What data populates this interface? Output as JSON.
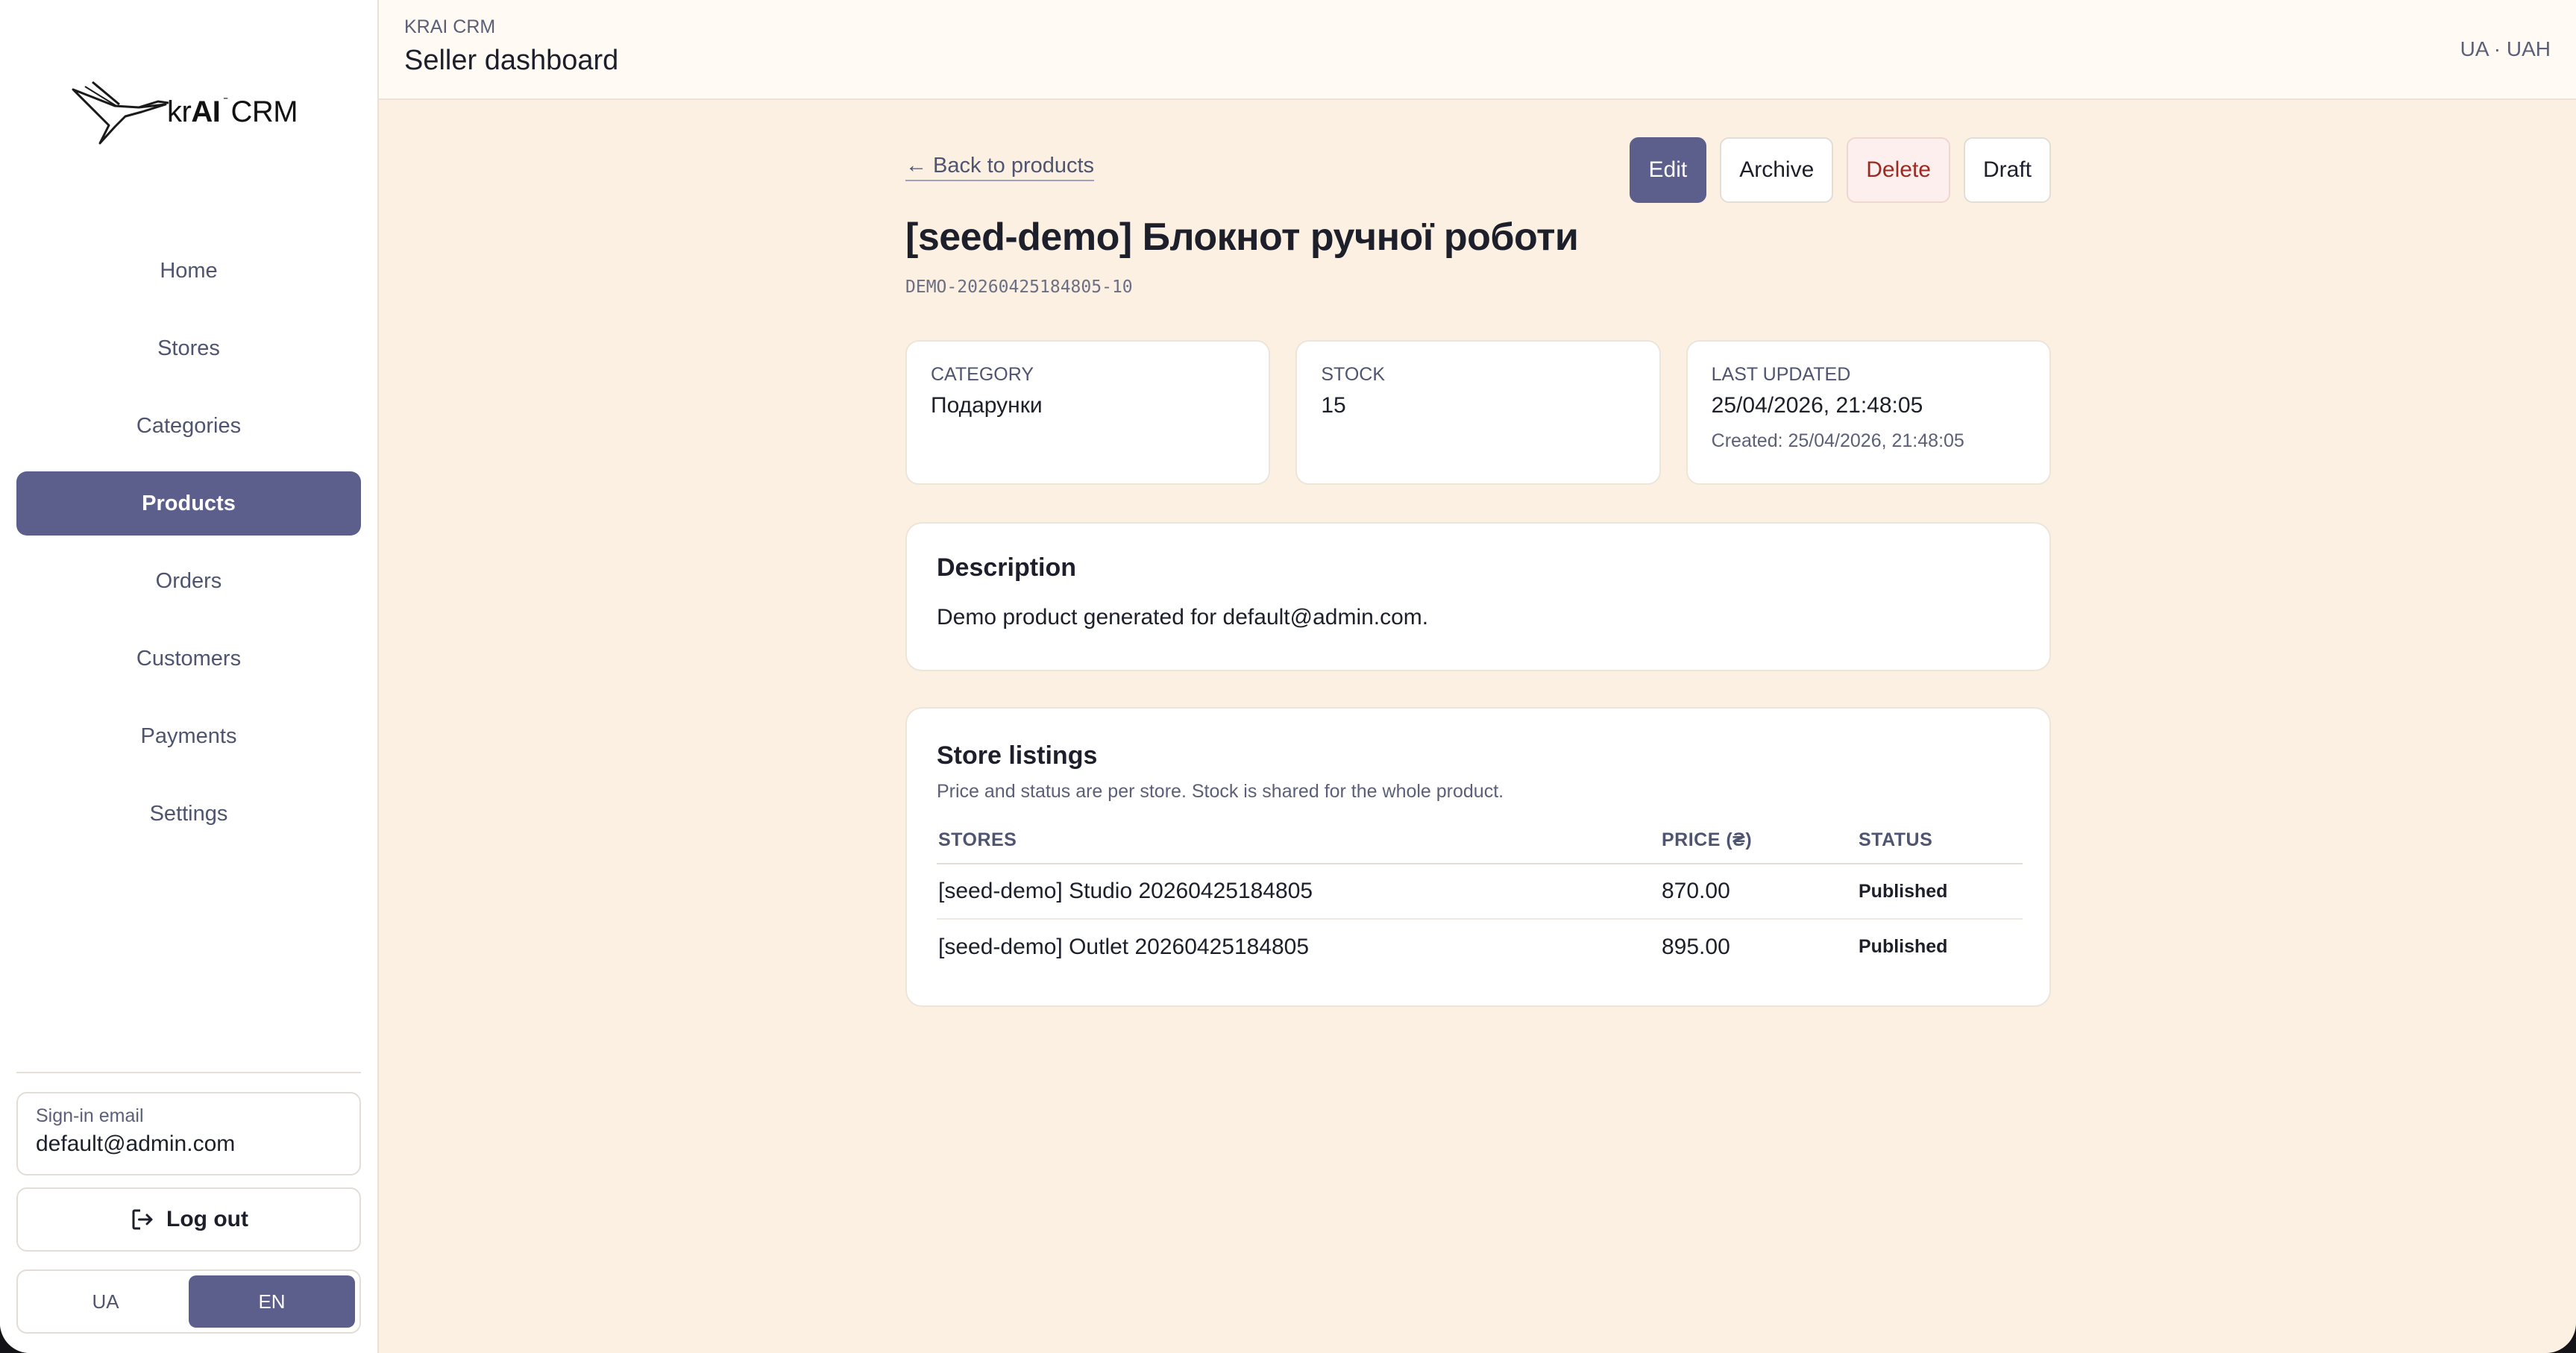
{
  "sidebar": {
    "logo": {
      "prefix": "kr",
      "ai": "AI",
      "sup": "ˉ",
      "suffix": "CRM"
    },
    "nav": [
      {
        "label": "Home"
      },
      {
        "label": "Stores"
      },
      {
        "label": "Categories"
      },
      {
        "label": "Products",
        "active": true
      },
      {
        "label": "Orders"
      },
      {
        "label": "Customers"
      },
      {
        "label": "Payments"
      },
      {
        "label": "Settings"
      }
    ],
    "signin_label": "Sign-in email",
    "signin_email": "default@admin.com",
    "logout_label": "Log out",
    "languages": [
      {
        "label": "UA",
        "active": false
      },
      {
        "label": "EN",
        "active": true
      }
    ]
  },
  "header": {
    "app_name": "KRAI CRM",
    "title": "Seller dashboard",
    "locale": "UA · UAH"
  },
  "product": {
    "back_link": "← Back to products",
    "actions": {
      "edit": "Edit",
      "archive": "Archive",
      "delete": "Delete",
      "draft": "Draft"
    },
    "title": "[seed-demo] Блокнот ручної роботи",
    "sku": "DEMO-20260425184805-10",
    "category_label": "CATEGORY",
    "category_value": "Подарунки",
    "stock_label": "STOCK",
    "stock_value": "15",
    "updated_label": "LAST UPDATED",
    "updated_value": "25/04/2026, 21:48:05",
    "created_text": "Created: 25/04/2026, 21:48:05"
  },
  "description": {
    "title": "Description",
    "text": "Demo product generated for default@admin.com."
  },
  "listings": {
    "title": "Store listings",
    "subtitle": "Price and status are per store. Stock is shared for the whole product.",
    "columns": [
      "STORES",
      "PRICE (₴)",
      "STATUS"
    ],
    "rows": [
      {
        "store": "[seed-demo] Studio 20260425184805",
        "price": "870.00",
        "status": "Published"
      },
      {
        "store": "[seed-demo] Outlet 20260425184805",
        "price": "895.00",
        "status": "Published"
      }
    ]
  },
  "colors": {
    "accent": "#5c5e8c",
    "page_bg": "#fbf0e2",
    "danger_text": "#9c2a22"
  }
}
